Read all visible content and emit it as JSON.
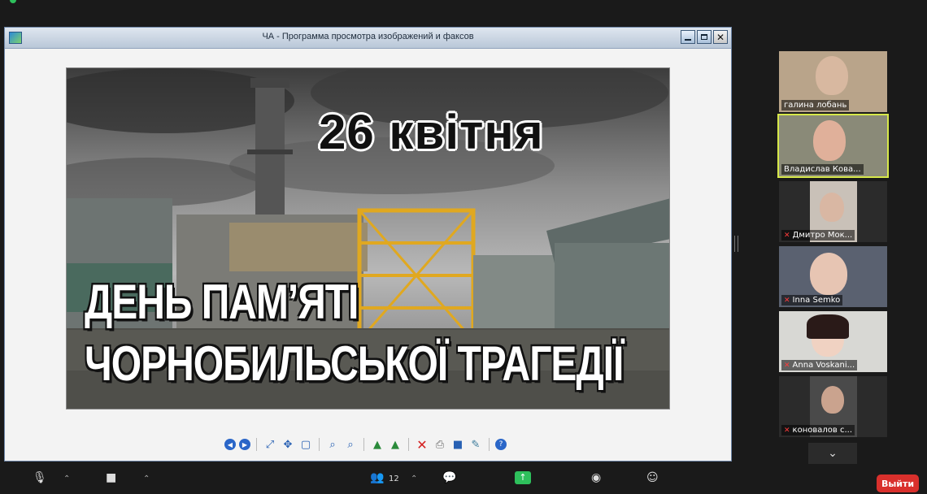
{
  "window": {
    "title": "ЧА - Программа просмотра изображений и факсов"
  },
  "poster": {
    "line1": "26 квітня",
    "line2": "ДЕНЬ ПАМ’ЯТІ",
    "line3": "ЧОРНОБИЛЬСЬКОЇ ТРАГЕДІЇ"
  },
  "toolbar_icons": [
    "prev-image-icon",
    "next-image-icon",
    "best-fit-icon",
    "actual-size-icon",
    "slideshow-icon",
    "zoom-in-icon",
    "zoom-out-icon",
    "rotate-clockwise-icon",
    "rotate-counterclockwise-icon",
    "delete-icon",
    "print-icon",
    "save-icon",
    "edit-icon",
    "help-icon"
  ],
  "participants": [
    {
      "name": "галина лобань",
      "muted": false,
      "active": false,
      "bg": "#b9a48a",
      "face": "#d8b8a0"
    },
    {
      "name": "Владислав Кова...",
      "muted": false,
      "active": true,
      "bg": "#8a8a78",
      "face": "#e0b09a"
    },
    {
      "name": "Дмитро Мок...",
      "muted": true,
      "active": false,
      "bg": "#c9c1b8",
      "face": "#d9b7a3"
    },
    {
      "name": "Inna Semko",
      "muted": true,
      "active": false,
      "bg": "#5a6170",
      "face": "#e7c5b3"
    },
    {
      "name": "Anna Voskani...",
      "muted": true,
      "active": false,
      "bg": "#d8d8d4",
      "face": "#f0d2c2"
    },
    {
      "name": "коновалов с...",
      "muted": true,
      "active": false,
      "bg": "#4a4a4a",
      "face": "#caa38e"
    }
  ],
  "bottombar": {
    "participants_count": "12",
    "leave_label": "Выйти"
  },
  "colors": {
    "active_speaker": "#d7e84a",
    "leave": "#d9302c",
    "share": "#2ec05c"
  }
}
